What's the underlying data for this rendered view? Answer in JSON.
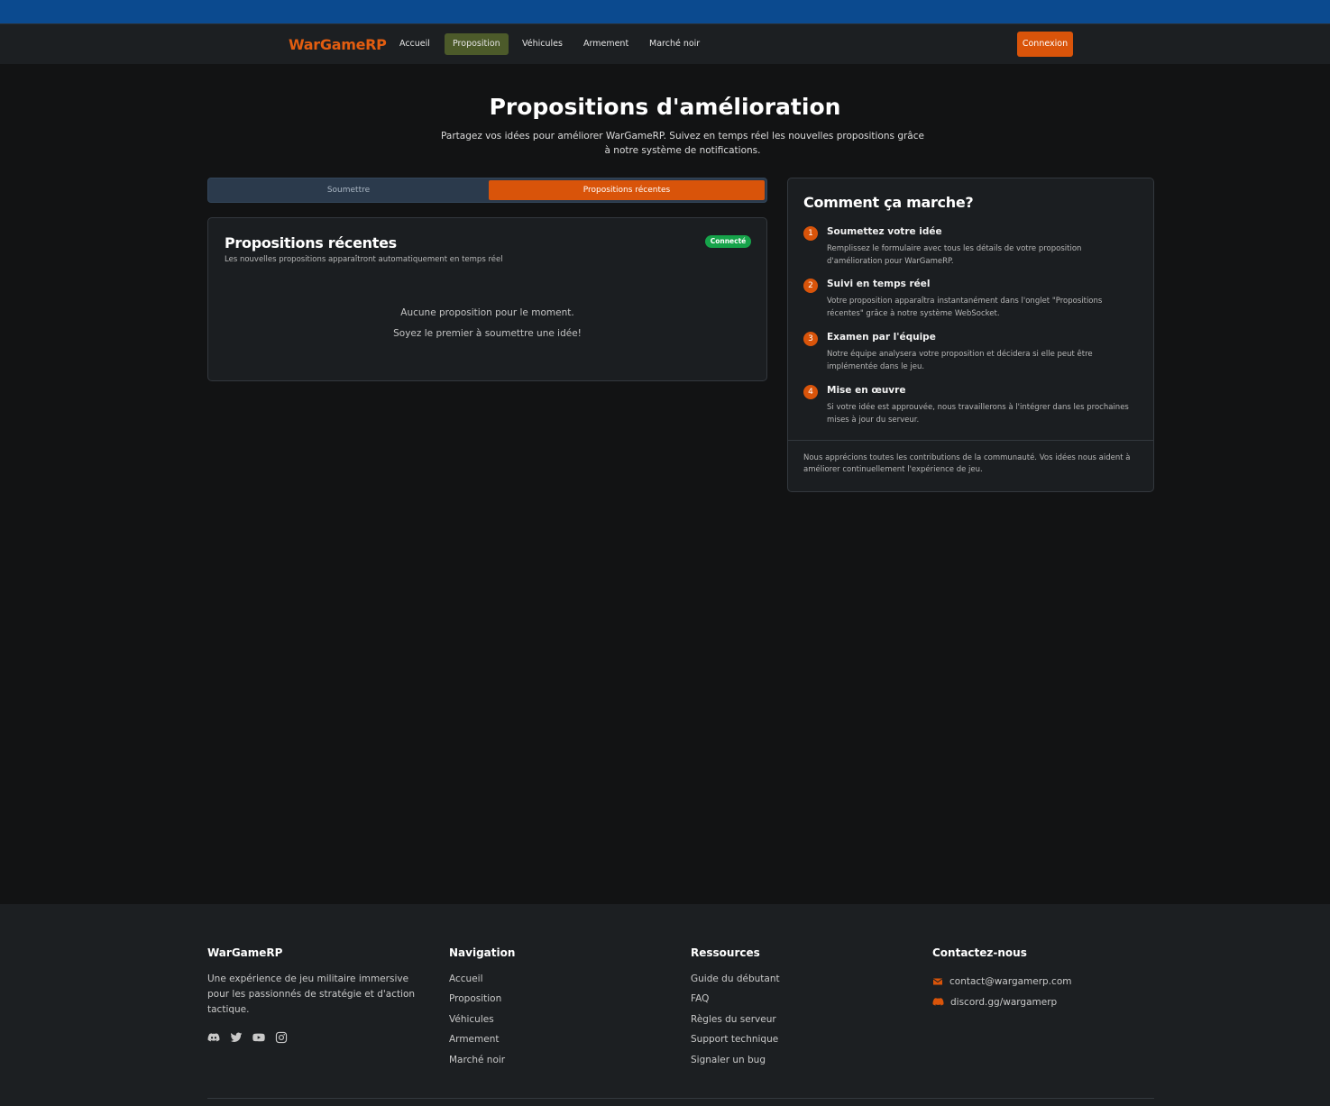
{
  "nav": {
    "brand": "WarGameRP",
    "items": [
      {
        "label": "Accueil",
        "active": false
      },
      {
        "label": "Proposition",
        "active": true
      },
      {
        "label": "Véhicules",
        "active": false
      },
      {
        "label": "Armement",
        "active": false
      },
      {
        "label": "Marché noir",
        "active": false
      }
    ],
    "login_label": "Connexion"
  },
  "page": {
    "title": "Propositions d'amélioration",
    "subtitle": "Partagez vos idées pour améliorer WarGameRP. Suivez en temps réel les nouvelles propositions grâce à notre système de notifications."
  },
  "tabs": [
    {
      "label": "Soumettre",
      "active": false
    },
    {
      "label": "Propositions récentes",
      "active": true
    }
  ],
  "recent": {
    "title": "Propositions récentes",
    "subtitle": "Les nouvelles propositions apparaîtront automatiquement en temps réel",
    "status_badge": "Connecté",
    "empty_line1": "Aucune proposition pour le moment.",
    "empty_line2": "Soyez le premier à soumettre une idée!"
  },
  "how": {
    "title": "Comment ça marche?",
    "steps": [
      {
        "num": "1",
        "title": "Soumettez votre idée",
        "text": "Remplissez le formulaire avec tous les détails de votre proposition d'amélioration pour WarGameRP."
      },
      {
        "num": "2",
        "title": "Suivi en temps réel",
        "text": "Votre proposition apparaîtra instantanément dans l'onglet \"Propositions récentes\" grâce à notre système WebSocket."
      },
      {
        "num": "3",
        "title": "Examen par l'équipe",
        "text": "Notre équipe analysera votre proposition et décidera si elle peut être implémentée dans le jeu."
      },
      {
        "num": "4",
        "title": "Mise en œuvre",
        "text": "Si votre idée est approuvée, nous travaillerons à l'intégrer dans les prochaines mises à jour du serveur."
      }
    ],
    "footer_text": "Nous apprécions toutes les contributions de la communauté. Vos idées nous aident à améliorer continuellement l'expérience de jeu."
  },
  "footer": {
    "brand": "WarGameRP",
    "description": "Une expérience de jeu militaire immersive pour les passionnés de stratégie et d'action tactique.",
    "socials": [
      "discord-icon",
      "twitter-icon",
      "youtube-icon",
      "instagram-icon"
    ],
    "navigation": {
      "heading": "Navigation",
      "links": [
        "Accueil",
        "Proposition",
        "Véhicules",
        "Armement",
        "Marché noir"
      ]
    },
    "resources": {
      "heading": "Ressources",
      "links": [
        "Guide du débutant",
        "FAQ",
        "Règles du serveur",
        "Support technique",
        "Signaler un bug"
      ]
    },
    "contact": {
      "heading": "Contactez-nous",
      "email": "contact@wargamerp.com",
      "discord": "discord.gg/wargamerp"
    }
  },
  "colors": {
    "accent": "#d9540a",
    "brand": "#e25d10",
    "active_nav": "#4c5a2a",
    "status_green": "#16a34a",
    "topbar": "#0b4a8f"
  }
}
